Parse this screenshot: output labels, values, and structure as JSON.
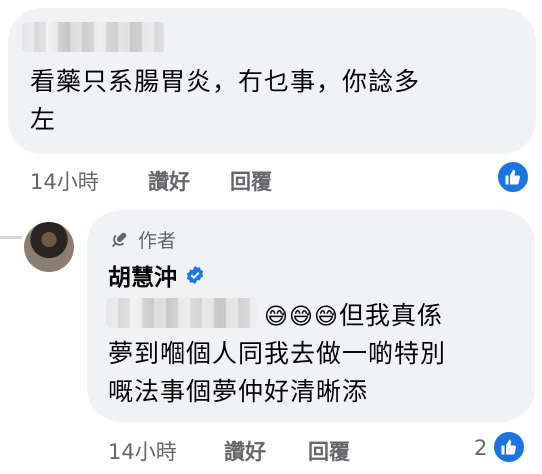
{
  "comment1": {
    "text_line1": "看藥只系腸胃炎，冇乜事，你諗多",
    "text_line2": "左",
    "time": "14小時",
    "like_label": "讚好",
    "reply_label": "回覆"
  },
  "comment2": {
    "author_badge": "作者",
    "name": "胡慧沖",
    "emojis": "😅😅😅",
    "text_line1_rest": "但我真係",
    "text_line2": "夢到嗰個人同我去做一啲特別",
    "text_line3": "嘅法事個夢仲好清晰添",
    "time": "14小時",
    "like_label": "讚好",
    "reply_label": "回覆",
    "reaction_count": "2"
  },
  "colors": {
    "bubble": "#f0f2f5",
    "like_blue": "#1b74e4",
    "meta_gray": "#65676b",
    "verified_blue": "#1877f2"
  }
}
